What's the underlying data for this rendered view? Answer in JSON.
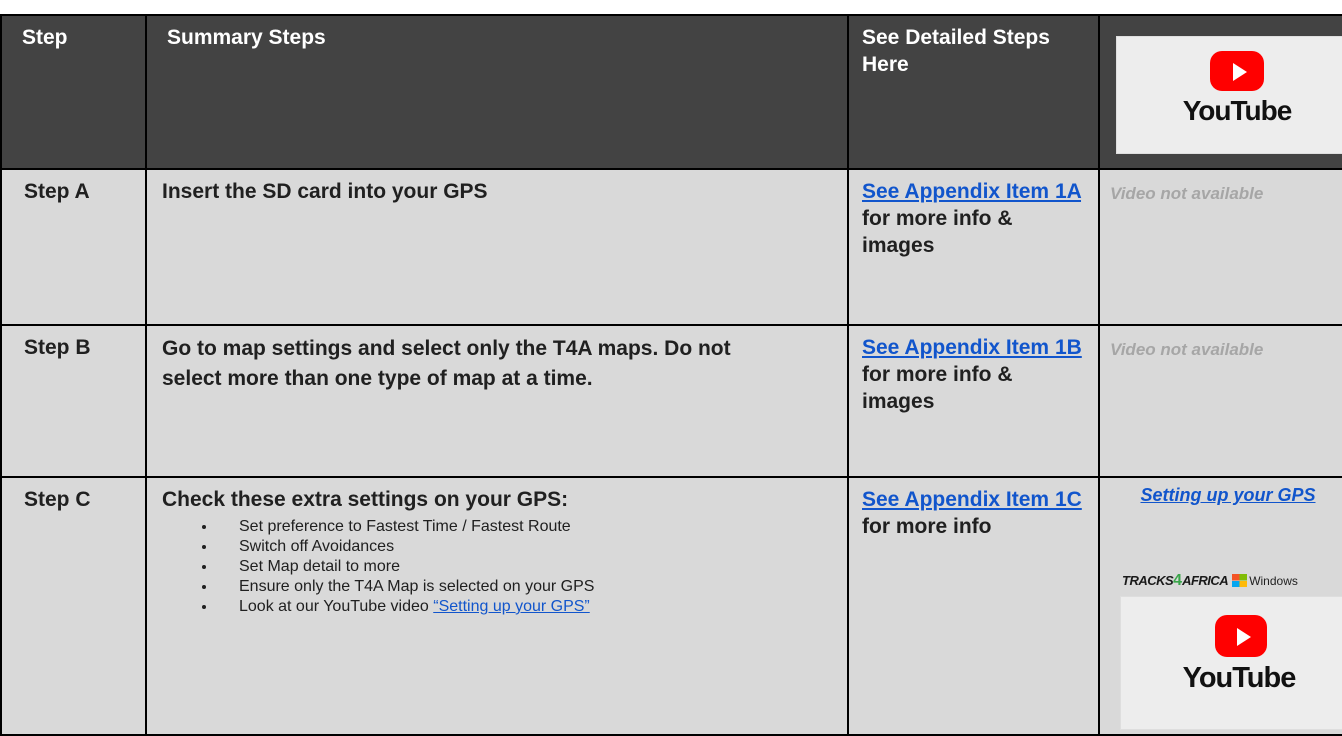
{
  "header": {
    "step": "Step",
    "summary": "Summary Steps",
    "detailed": "See Detailed Steps Here",
    "youtube_word": "YouTube"
  },
  "rows": [
    {
      "step": "Step A",
      "summary": "Insert the SD card into your GPS",
      "link": "See Appendix Item 1A",
      "link_suffix": " for more info & images",
      "video": "Video not available"
    },
    {
      "step": "Step B",
      "summary": "Go to map settings and select only the T4A maps.  Do not select more than one type of map at a time.",
      "link": "See Appendix Item 1B",
      "link_suffix": " for more info & images",
      "video": "Video not available"
    },
    {
      "step": "Step C",
      "summary": "Check these extra settings on your GPS:",
      "bullets": [
        "Set preference to Fastest Time / Fastest Route",
        "Switch off Avoidances",
        "Set Map detail to more",
        "Ensure only the T4A Map is selected on your GPS"
      ],
      "last_bullet_prefix": "Look at our YouTube video ",
      "last_bullet_link": "“Setting up your GPS”",
      "link": "See Appendix Item 1C",
      "link_suffix": " for more info",
      "video_link": "Setting up your GPS",
      "brand_tracks": "TRACKS",
      "brand_four": "4",
      "brand_africa": "AFRICA",
      "brand_windows": "Windows",
      "youtube_word": "YouTube"
    }
  ],
  "colors": {
    "header_bg": "#434343",
    "body_bg": "#d9d9d9",
    "link": "#1155cc",
    "youtube_red": "#ff0000"
  },
  "icons": [
    "youtube-logo",
    "tracks4africa-logo",
    "windows-logo",
    "bullet-dot"
  ]
}
